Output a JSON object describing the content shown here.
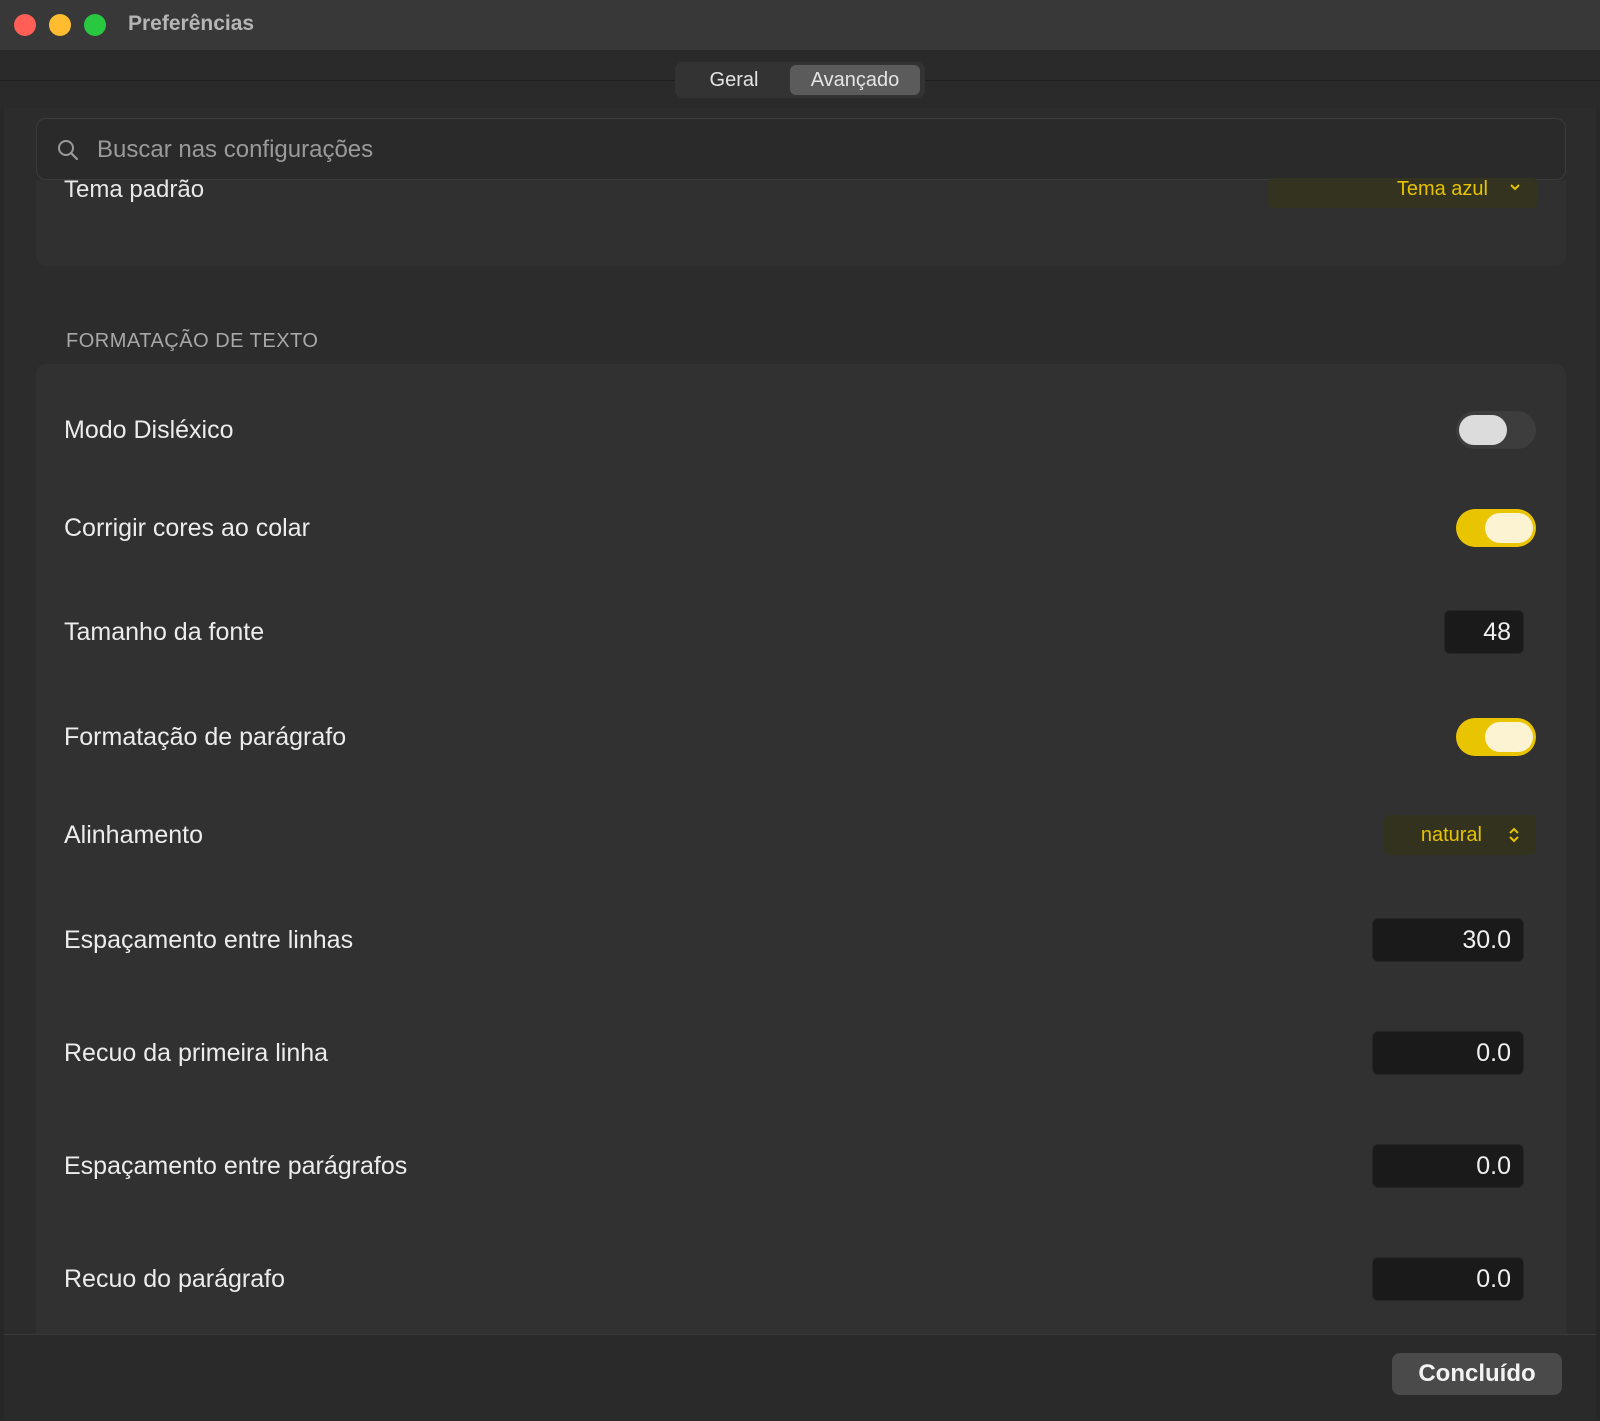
{
  "window": {
    "title": "Preferências"
  },
  "tabs": [
    {
      "label": "Geral",
      "active": false
    },
    {
      "label": "Avançado",
      "active": true
    }
  ],
  "search": {
    "placeholder": "Buscar nas configurações",
    "value": ""
  },
  "partial_row": {
    "label": "Tema padrão",
    "value": "Tema azul"
  },
  "section": {
    "header": "FORMATAÇÃO DE TEXTO",
    "rows": [
      {
        "label": "Modo Disléxico",
        "control": "toggle",
        "on": false
      },
      {
        "label": "Corrigir cores ao colar",
        "control": "toggle",
        "on": true
      },
      {
        "label": "Tamanho da fonte",
        "control": "number",
        "value": "48"
      },
      {
        "label": "Formatação de parágrafo",
        "control": "toggle",
        "on": true
      },
      {
        "label": "Alinhamento",
        "control": "popup",
        "value": "natural"
      },
      {
        "label": "Espaçamento entre linhas",
        "control": "number",
        "value": "30.0"
      },
      {
        "label": "Recuo da primeira linha",
        "control": "number",
        "value": "0.0"
      },
      {
        "label": "Espaçamento entre parágrafos",
        "control": "number",
        "value": "0.0"
      },
      {
        "label": "Recuo do parágrafo",
        "control": "number",
        "value": "0.0"
      }
    ]
  },
  "footer": {
    "done_label": "Concluído"
  },
  "colors": {
    "accent": "#e9c400",
    "accent_text": "#e6c200",
    "background": "#2c2c2c",
    "group_background": "#313131"
  },
  "icons": {
    "search": "magnifier-icon",
    "popup": "updown-chevron-icon"
  }
}
